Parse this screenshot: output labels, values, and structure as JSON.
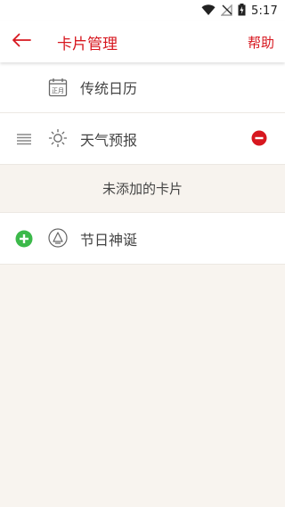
{
  "status_bar": {
    "time": "5:17",
    "icons": [
      "wifi-icon",
      "no-signal-icon",
      "battery-charging-icon"
    ]
  },
  "app_bar": {
    "back_icon": "arrow-left-icon",
    "title": "卡片管理",
    "help_label": "帮助"
  },
  "added_cards": [
    {
      "label": "传统日历",
      "icon": "calendar-icon",
      "icon_text": "正月",
      "removable": false,
      "draggable": false
    },
    {
      "label": "天气预报",
      "icon": "sun-icon",
      "removable": true,
      "draggable": true
    }
  ],
  "unadded_section": {
    "title": "未添加的卡片"
  },
  "unadded_cards": [
    {
      "label": "节日神诞",
      "icon": "bell-icon"
    }
  ],
  "colors": {
    "accent_red": "#d7171f",
    "add_green": "#3cb94a",
    "background": "#f8f4ef"
  }
}
